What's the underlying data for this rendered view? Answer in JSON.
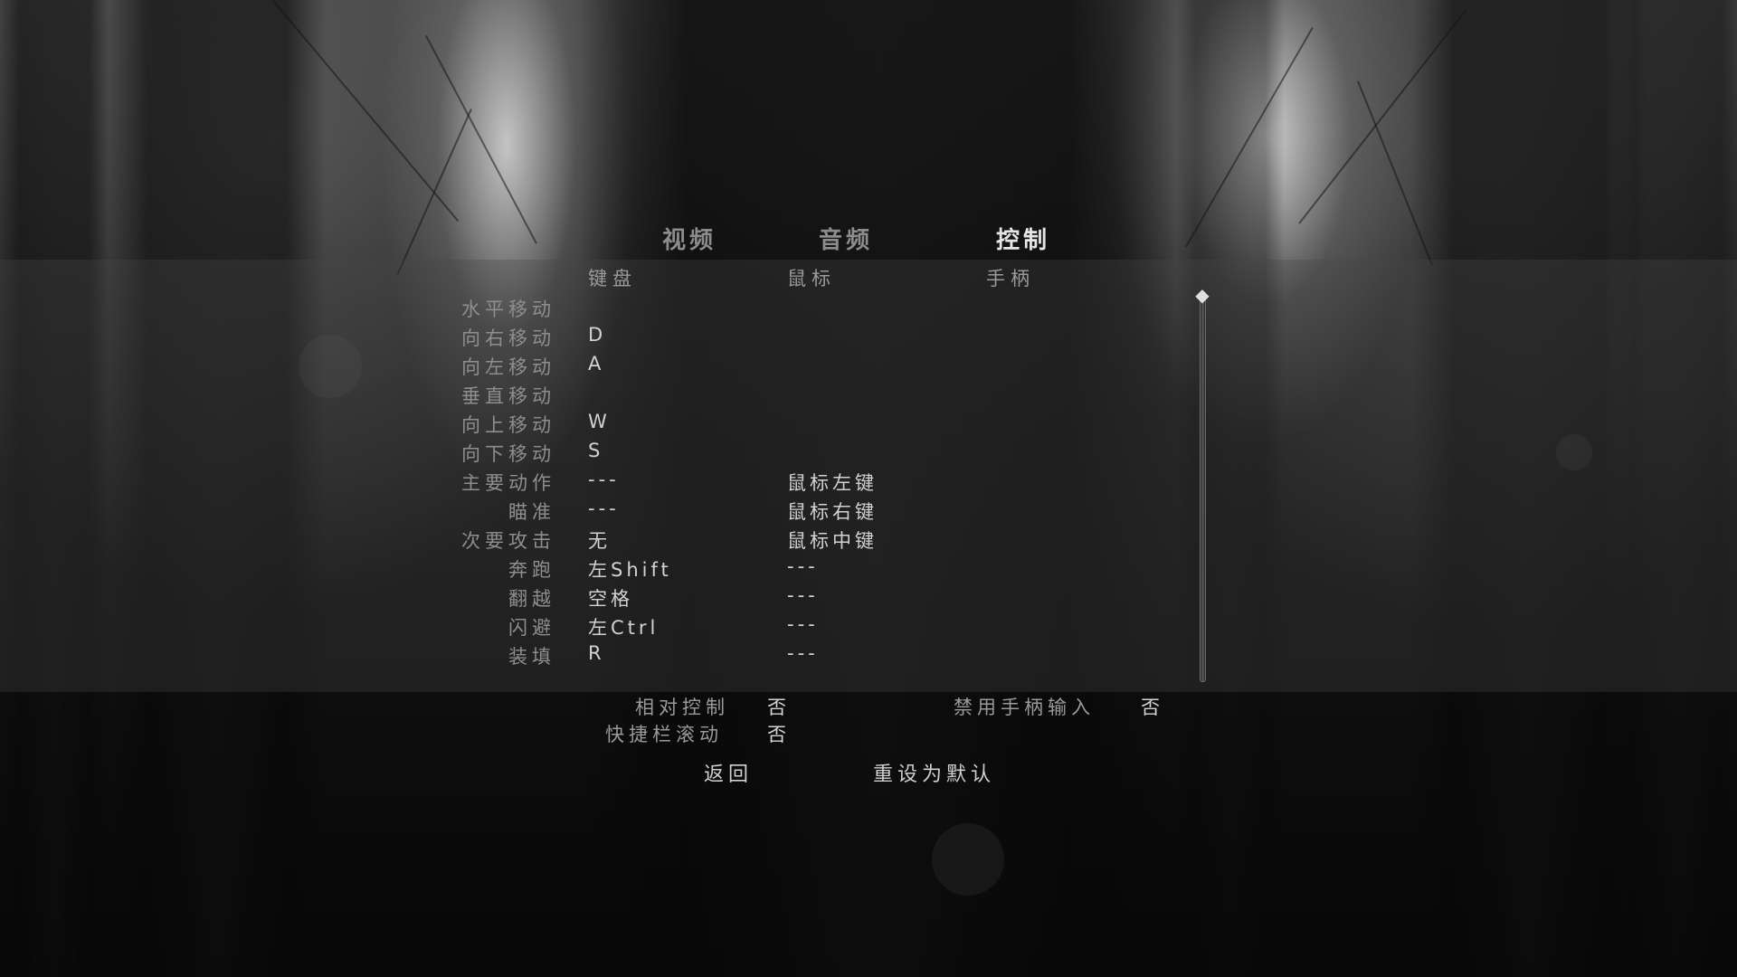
{
  "tabs": [
    {
      "label": "视频",
      "active": false
    },
    {
      "label": "音频",
      "active": false
    },
    {
      "label": "控制",
      "active": true
    }
  ],
  "columns": {
    "keyboard": "键盘",
    "mouse": "鼠标",
    "gamepad": "手柄"
  },
  "bindings": [
    {
      "action": "水平移动",
      "keyboard": "",
      "mouse": ""
    },
    {
      "action": "向右移动",
      "keyboard": "D",
      "mouse": ""
    },
    {
      "action": "向左移动",
      "keyboard": "A",
      "mouse": ""
    },
    {
      "action": "垂直移动",
      "keyboard": "",
      "mouse": ""
    },
    {
      "action": "向上移动",
      "keyboard": "W",
      "mouse": ""
    },
    {
      "action": "向下移动",
      "keyboard": "S",
      "mouse": ""
    },
    {
      "action": "主要动作",
      "keyboard": "---",
      "mouse": "鼠标左键"
    },
    {
      "action": "瞄准",
      "keyboard": "---",
      "mouse": "鼠标右键"
    },
    {
      "action": "次要攻击",
      "keyboard": "无",
      "mouse": "鼠标中键"
    },
    {
      "action": "奔跑",
      "keyboard": "左Shift",
      "mouse": "---"
    },
    {
      "action": "翻越",
      "keyboard": "空格",
      "mouse": "---"
    },
    {
      "action": "闪避",
      "keyboard": "左Ctrl",
      "mouse": "---"
    },
    {
      "action": "装填",
      "keyboard": "R",
      "mouse": "---"
    }
  ],
  "options": {
    "relative_control": {
      "label": "相对控制",
      "value": "否"
    },
    "hotbar_scroll": {
      "label": "快捷栏滚动",
      "value": "否"
    },
    "disable_gamepad": {
      "label": "禁用手柄输入",
      "value": "否"
    }
  },
  "actions": {
    "back": "返回",
    "reset": "重设为默认"
  },
  "scrollbar": {
    "icon": "diamond-icon",
    "position": 0
  }
}
